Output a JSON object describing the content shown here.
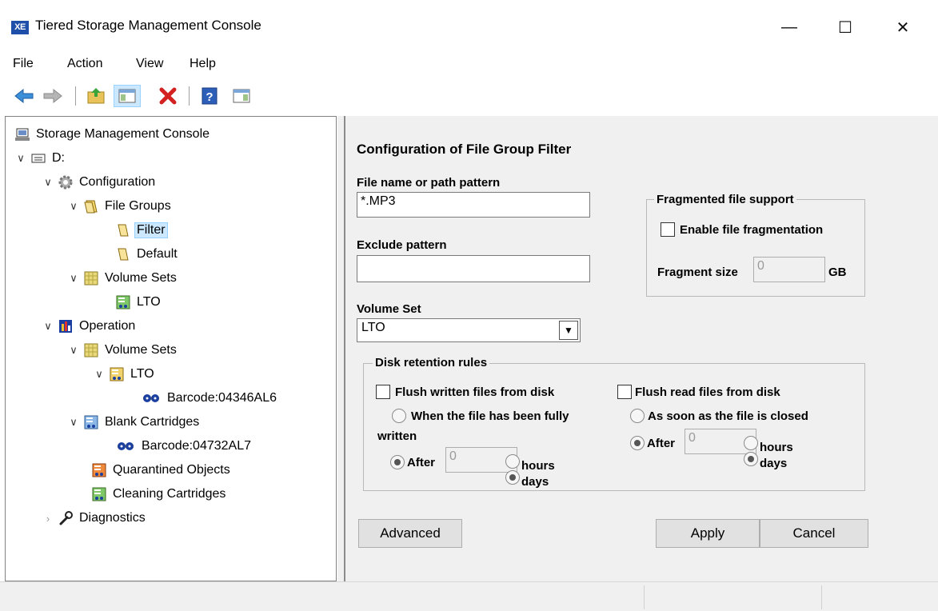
{
  "window": {
    "app_icon_text": "XE",
    "title": "Tiered Storage Management Console",
    "minimize": "—",
    "maximize": "☐",
    "close": "✕"
  },
  "menu": [
    "File",
    "Action",
    "View",
    "Help"
  ],
  "toolbar": {
    "icons": [
      "back-arrow-icon",
      "forward-arrow-icon",
      "up-folder-icon",
      "show-hide-console-tree-icon",
      "delete-icon",
      "help-icon",
      "show-action-pane-icon"
    ]
  },
  "tree": {
    "root": "Storage Management Console",
    "drive": "D:",
    "configuration": "Configuration",
    "file_groups": "File Groups",
    "filter": "Filter",
    "default": "Default",
    "volume_sets_cfg": "Volume Sets",
    "lto_cfg": "LTO",
    "operation": "Operation",
    "volume_sets_op": "Volume Sets",
    "lto_op": "LTO",
    "barcode_1": "Barcode:04346AL6",
    "blank_cartridges": "Blank Cartridges",
    "barcode_2": "Barcode:04732AL7",
    "quarantined": "Quarantined Objects",
    "cleaning": "Cleaning Cartridges",
    "diagnostics": "Diagnostics"
  },
  "form": {
    "heading": "Configuration of File Group Filter",
    "file_pattern_label": "File name or path pattern",
    "file_pattern_value": "*.MP3",
    "exclude_label": "Exclude pattern",
    "exclude_value": "",
    "volume_set_label": "Volume Set",
    "volume_set_value": "LTO",
    "fragmented": {
      "title": "Fragmented file support",
      "enable_label": "Enable file fragmentation",
      "size_label": "Fragment size",
      "size_value": "0",
      "unit": "GB"
    },
    "retention": {
      "title": "Disk retention rules",
      "flush_written_label": "Flush written files from disk",
      "written_radio_label": "When the file has been fully written",
      "written_radio_line1": "When the file has been fully",
      "written_radio_line2": "written",
      "after_label": "After",
      "after_written_value": "0",
      "hours": "hours",
      "days": "days",
      "flush_read_label": "Flush read files from disk",
      "read_radio_label": "As soon as the file is closed",
      "after_read_value": "0"
    },
    "buttons": {
      "advanced": "Advanced",
      "apply": "Apply",
      "cancel": "Cancel"
    }
  },
  "colors": {
    "accent": "#1f4fa8",
    "selection": "#cce8ff",
    "panel": "#f0f0f0"
  }
}
